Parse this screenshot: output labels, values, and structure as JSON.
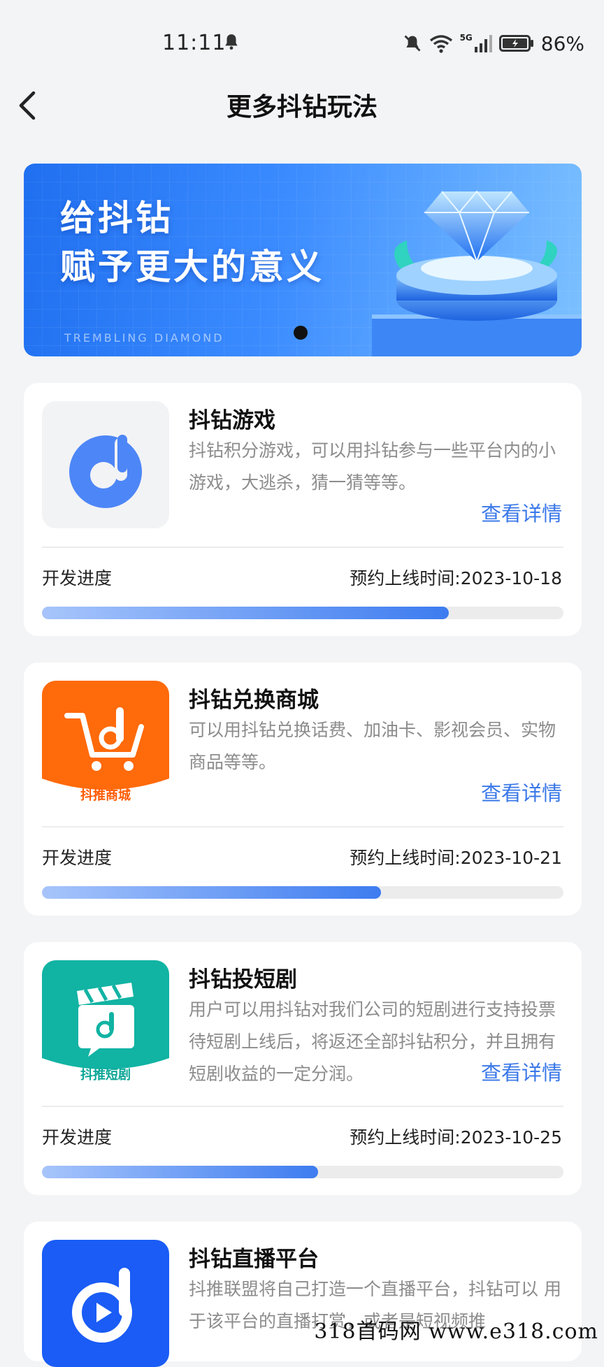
{
  "status_bar": {
    "time": "11:11",
    "network": "5G",
    "battery": "86%",
    "icons": [
      "bell-icon",
      "mute-icon",
      "wifi-icon",
      "signal-icon",
      "battery-icon"
    ]
  },
  "header": {
    "title": "更多抖钻玩法",
    "back_icon": "chevron-left-icon"
  },
  "banner": {
    "line1": "给抖钻",
    "line2": "赋予更大的意义",
    "subtitle": "TREMBLING DIAMOND",
    "colors": {
      "start": "#1f6ff0",
      "end": "#7cc1ff"
    }
  },
  "cards": [
    {
      "title": "抖钻游戏",
      "description": "抖钻积分游戏，可以用抖钻参与一些平台内的小游戏，大逃杀，猜一猜等等。",
      "detail_label": "查看详情",
      "progress_label": "开发进度",
      "launch_date": "预约上线时间:2023-10-18",
      "progress": 0.78,
      "icon": "music-note-d-icon",
      "icon_bg": "#f2f3f5"
    },
    {
      "title": "抖钻兑换商城",
      "description": "可以用抖钻兑换话费、加油卡、影视会员、实物商品等等。",
      "detail_label": "查看详情",
      "progress_label": "开发进度",
      "launch_date": "预约上线时间:2023-10-21",
      "progress": 0.65,
      "icon": "shopping-cart-icon",
      "icon_caption": "抖推商城",
      "icon_bg": "#ff6a0a"
    },
    {
      "title": "抖钻投短剧",
      "description": "用户可以用抖钻对我们公司的短剧进行支持投票待短剧上线后，将返还全部抖钻积分，并且拥有短剧收益的一定分润。",
      "detail_label": "查看详情",
      "progress_label": "开发进度",
      "launch_date": "预约上线时间:2023-10-25",
      "progress": 0.53,
      "icon": "clapperboard-icon",
      "icon_caption": "抖推短剧",
      "icon_bg": "#11b3a3"
    },
    {
      "title": "抖钻直播平台",
      "description": "抖推联盟将自己打造一个直播平台，抖钻可以 用于该平台的直播打赏，或者是短视频推",
      "icon": "play-d-icon",
      "icon_bg": "#1a5cf5"
    }
  ],
  "watermark": "318首码网 www.e318.com"
}
